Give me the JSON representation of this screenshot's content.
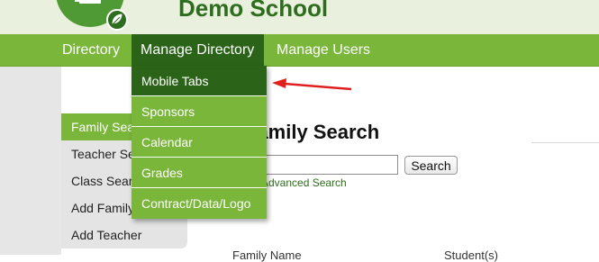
{
  "header": {
    "title": "Demo School",
    "logo_icon": "school-logo-icon",
    "leaf_icon": "leaf-icon"
  },
  "nav": {
    "items": [
      {
        "label": "Directory"
      },
      {
        "label": "Manage Directory"
      },
      {
        "label": "Manage Users"
      }
    ]
  },
  "dropdown": {
    "items": [
      {
        "label": "Mobile Tabs"
      },
      {
        "label": "Sponsors"
      },
      {
        "label": "Calendar"
      },
      {
        "label": "Grades"
      },
      {
        "label": "Contract/Data/Logo"
      }
    ]
  },
  "sidebar": {
    "items": [
      {
        "label": "Family Search"
      },
      {
        "label": "Teacher Search"
      },
      {
        "label": "Class Search"
      },
      {
        "label": "Add Family"
      },
      {
        "label": "Add Teacher"
      }
    ]
  },
  "main": {
    "title": "Family Search",
    "search_button": "Search",
    "advanced_link": "Advanced Search",
    "columns": [
      "Family Name",
      "Student(s)"
    ]
  },
  "annotation": {
    "arrow": "red-arrow",
    "color": "#e02020"
  },
  "colors": {
    "nav_green": "#7ab63a",
    "dark_green": "#2b6418",
    "title_green": "#2e6d1d"
  }
}
